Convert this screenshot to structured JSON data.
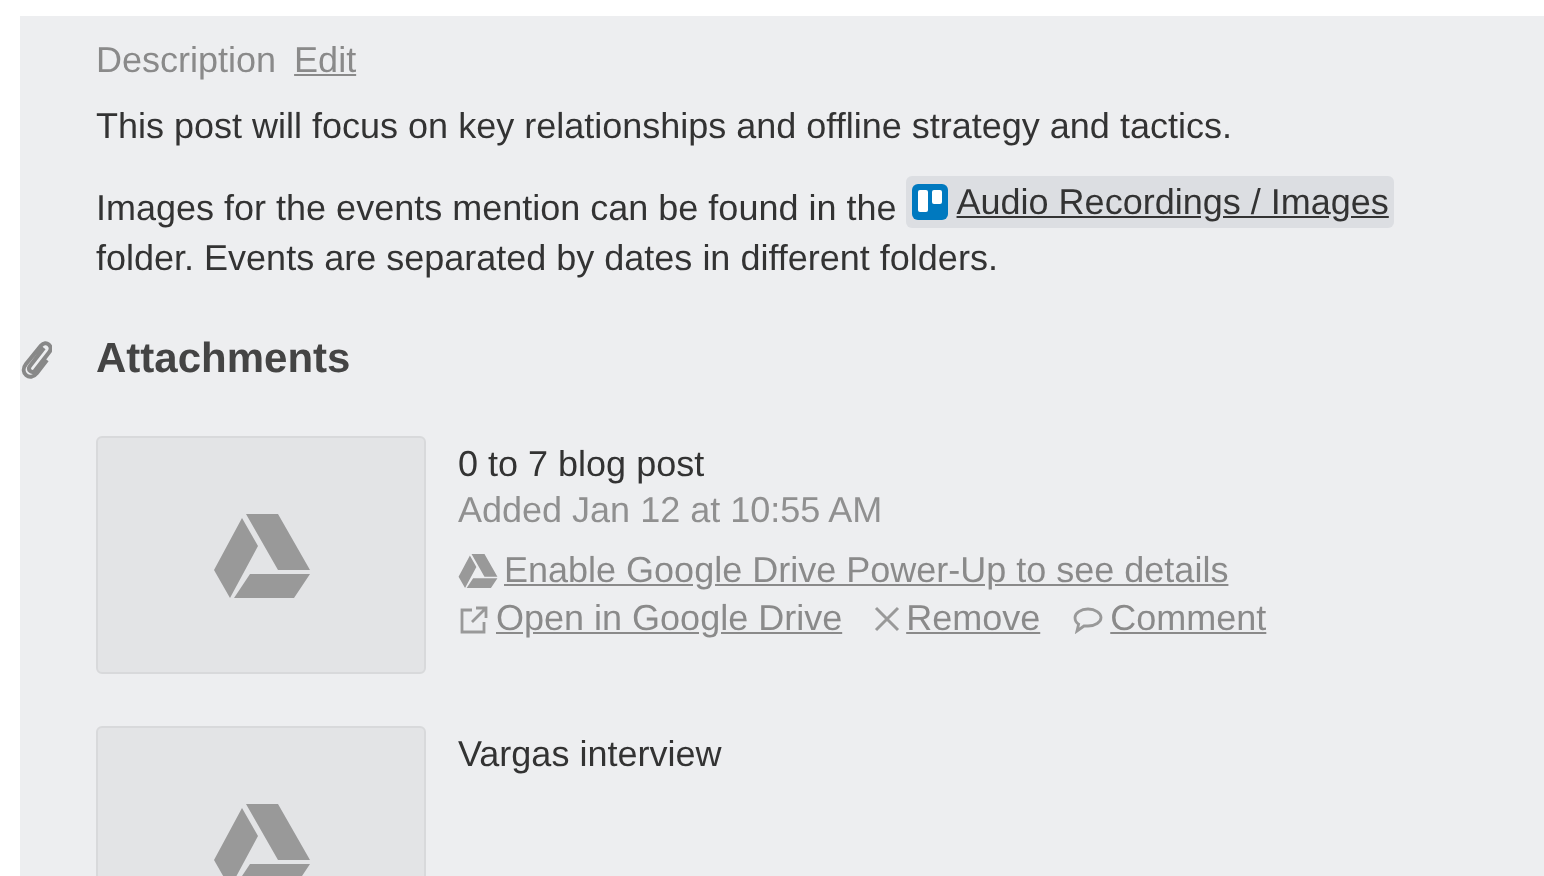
{
  "description": {
    "label": "Description",
    "edit": "Edit",
    "paragraphs": [
      {
        "kind": "plain",
        "text": "This post will focus on key relationships and offline strategy and tactics."
      },
      {
        "kind": "link",
        "before": "Images for the events mention can be found in the",
        "link": "Audio Recordings / Images",
        "after": "folder. Events are separated by dates in different folders."
      }
    ]
  },
  "attachments": {
    "title": "Attachments",
    "items": [
      {
        "name": "0 to 7 blog post",
        "added": "Added Jan 12 at 10:55 AM",
        "notice": "Enable Google Drive Power-Up to see details",
        "actions": [
          {
            "kind": "open",
            "label": "Open in Google Drive"
          },
          {
            "kind": "remove",
            "label": "Remove"
          },
          {
            "kind": "comment",
            "label": "Comment"
          }
        ]
      },
      {
        "name": "Vargas interview"
      }
    ]
  }
}
